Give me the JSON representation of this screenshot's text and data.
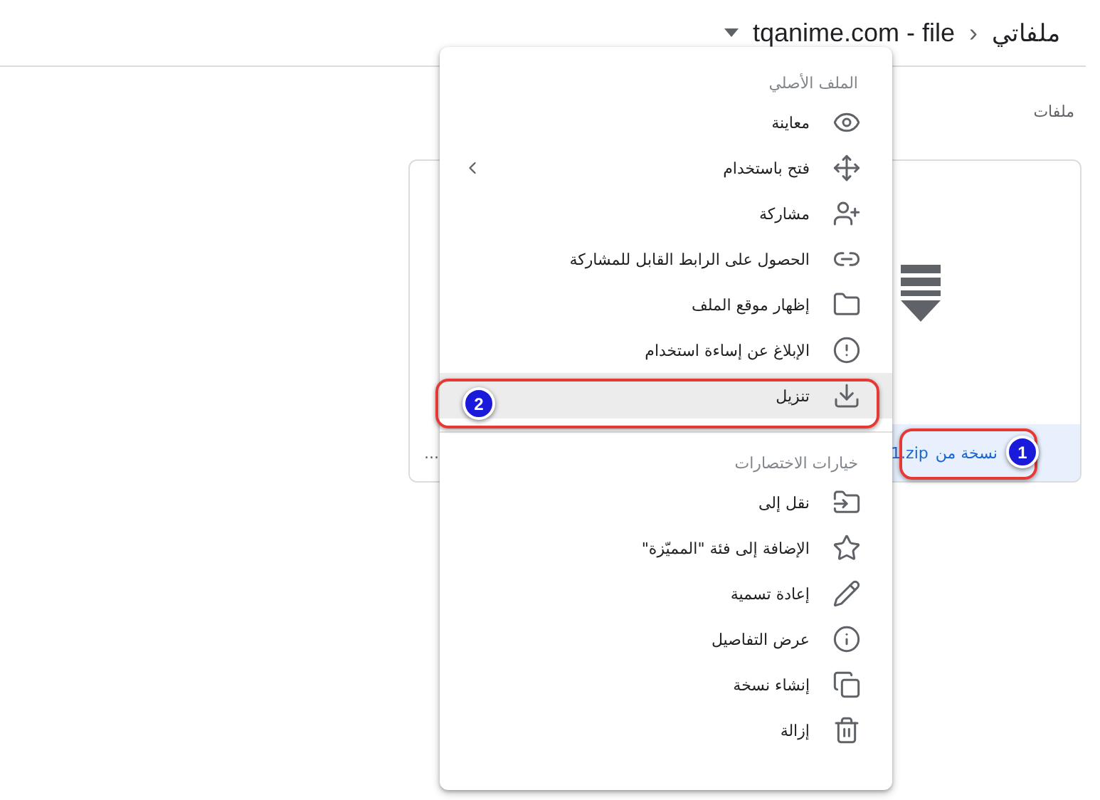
{
  "breadcrumb": {
    "root": "ملفاتي",
    "separator": "›",
    "current": "tqanime.com - file"
  },
  "section_label": "ملفات",
  "file_card": {
    "name_parts": [
      "نسخة من",
      "1.zip"
    ],
    "more": "...",
    "selected": true
  },
  "context_menu": {
    "sections": [
      {
        "title": "الملف الأصلي",
        "items": [
          {
            "label": "معاينة",
            "has_submenu": false,
            "selected": false
          },
          {
            "label": "فتح باستخدام",
            "has_submenu": true,
            "selected": false
          },
          {
            "label": "مشاركة",
            "has_submenu": false,
            "selected": false
          },
          {
            "label": "الحصول على الرابط القابل للمشاركة",
            "has_submenu": false,
            "selected": false
          },
          {
            "label": "إظهار موقع الملف",
            "has_submenu": false,
            "selected": false
          },
          {
            "label": "الإبلاغ عن إساءة استخدام",
            "has_submenu": false,
            "selected": false
          },
          {
            "label": "تنزيل",
            "has_submenu": false,
            "selected": true
          }
        ]
      },
      {
        "title": "خيارات الاختصارات",
        "items": [
          {
            "label": "نقل إلى",
            "has_submenu": false,
            "selected": false
          },
          {
            "label": "الإضافة إلى فئة \"المميّزة\"",
            "has_submenu": false,
            "selected": false
          },
          {
            "label": "إعادة تسمية",
            "has_submenu": false,
            "selected": false
          },
          {
            "label": "عرض التفاصيل",
            "has_submenu": false,
            "selected": false
          },
          {
            "label": "إنشاء نسخة",
            "has_submenu": false,
            "selected": false
          },
          {
            "label": "إزالة",
            "has_submenu": false,
            "selected": false
          }
        ]
      }
    ]
  },
  "annotations": [
    {
      "number": "1"
    },
    {
      "number": "2"
    }
  ]
}
